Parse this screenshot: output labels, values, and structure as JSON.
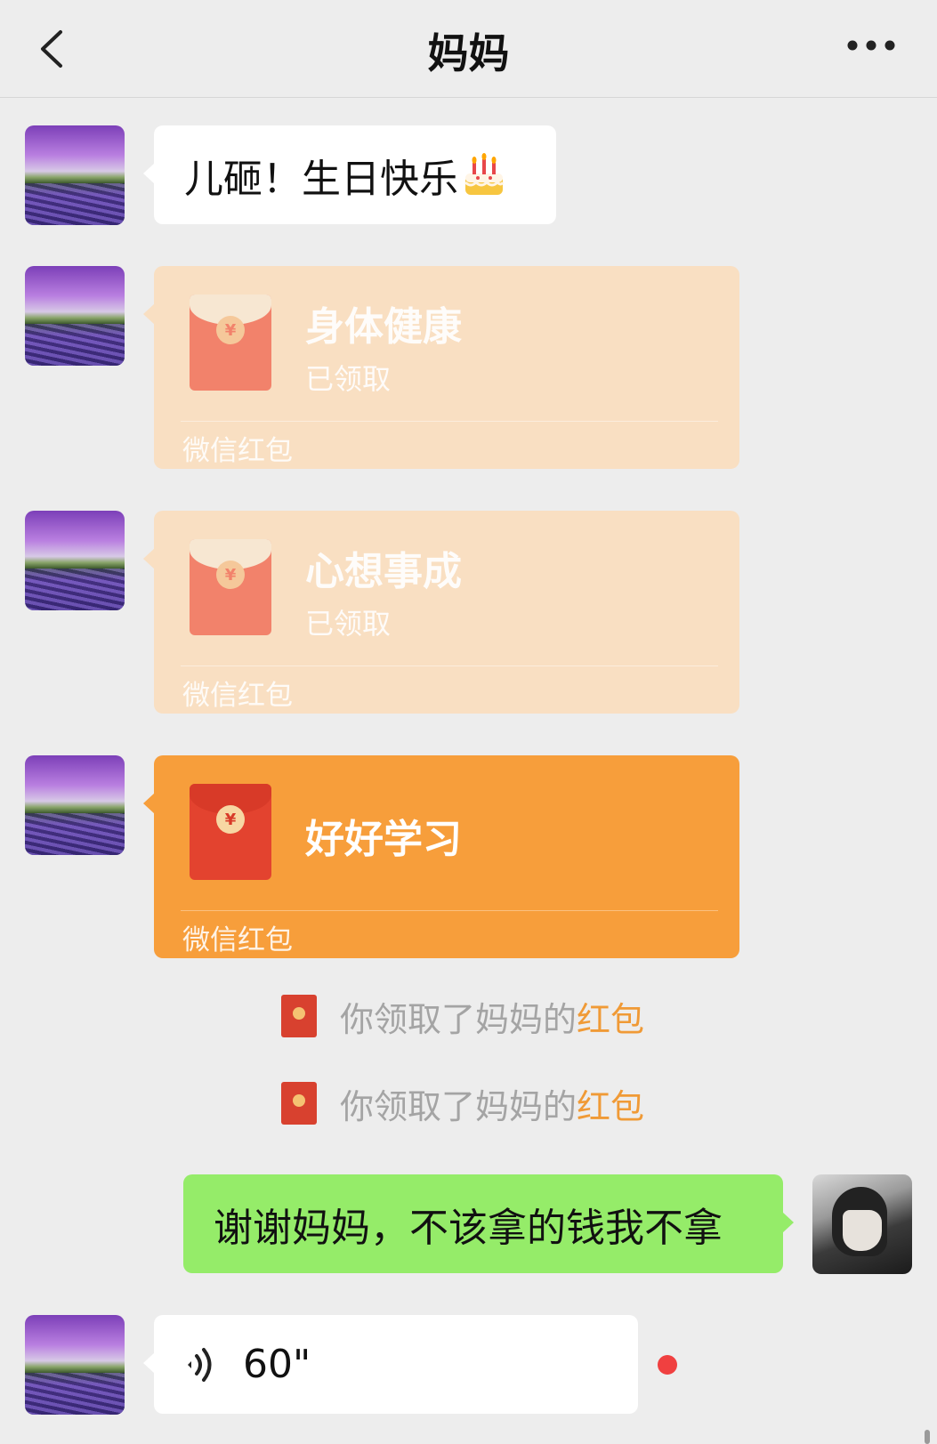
{
  "header": {
    "title": "妈妈"
  },
  "messages": {
    "greeting": "儿砸！生日快乐",
    "packet1": {
      "wish": "身体健康",
      "status": "已领取",
      "brand": "微信红包"
    },
    "packet2": {
      "wish": "心想事成",
      "status": "已领取",
      "brand": "微信红包"
    },
    "packet3": {
      "wish": "好好学习",
      "brand": "微信红包"
    },
    "notice1": {
      "text": "你领取了妈妈的",
      "link": "红包"
    },
    "notice2": {
      "text": "你领取了妈妈的",
      "link": "红包"
    },
    "reply": "谢谢妈妈，不该拿的钱我不拿",
    "voice": {
      "duration": "60\""
    }
  },
  "icons": {
    "back": "chevron-left-icon",
    "more": "more-dots-icon",
    "cake": "birthday-cake-emoji",
    "voice": "voice-wave-icon",
    "packet": "red-envelope-icon"
  },
  "colors": {
    "background": "#ededed",
    "green_bubble": "#95ec69",
    "packet_active": "#f79e3b",
    "packet_received": "#f9dfc2",
    "link": "#f09a36",
    "unread": "#f04040"
  }
}
